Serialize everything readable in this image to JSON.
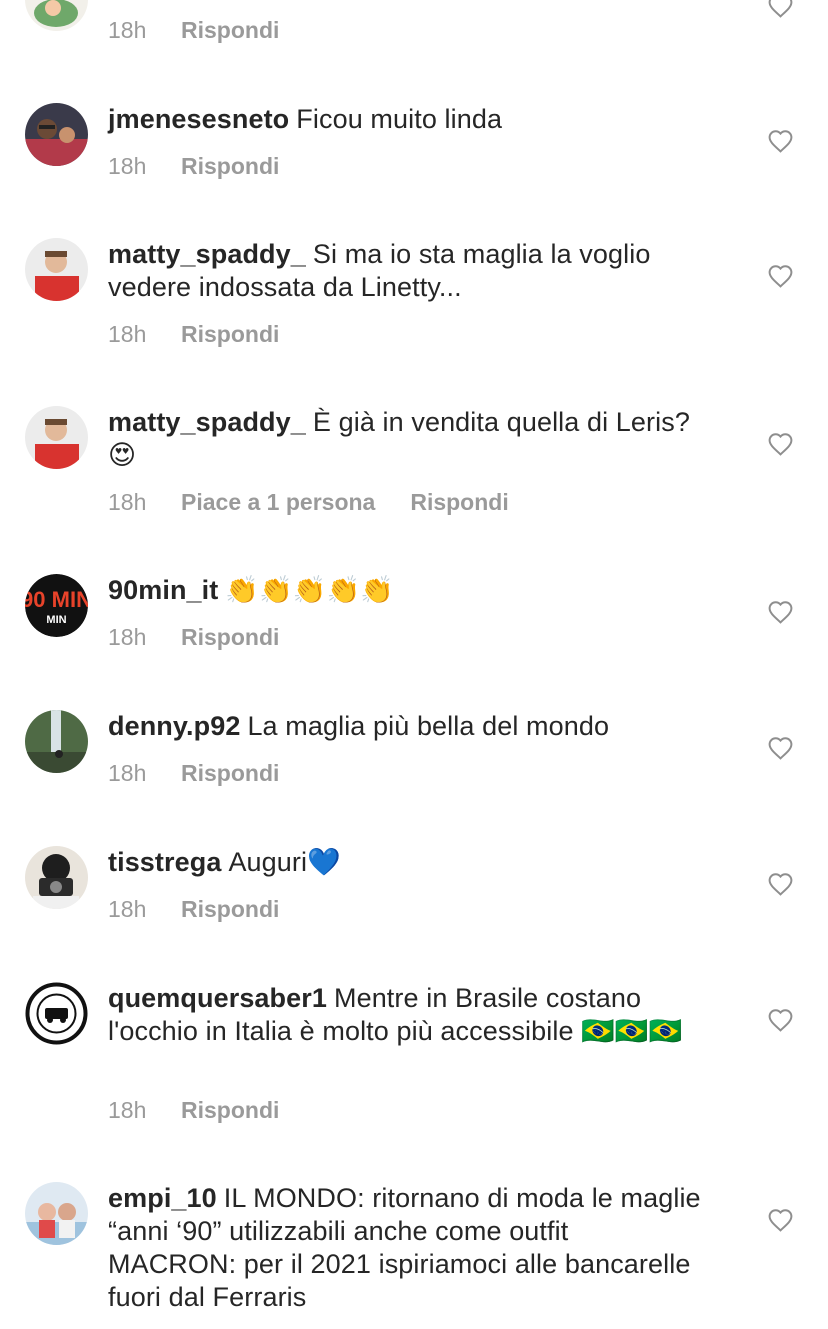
{
  "comments": [
    {
      "username": "",
      "text": "",
      "time": "18h",
      "reply": "Rispondi"
    },
    {
      "username": "jmenesesneto",
      "text": "Ficou muito linda",
      "time": "18h",
      "reply": "Rispondi"
    },
    {
      "username": "matty_spaddy_",
      "text": "Si ma io sta maglia la voglio vedere indossata da Linetty...",
      "time": "18h",
      "reply": "Rispondi"
    },
    {
      "username": "matty_spaddy_",
      "text": "È già in vendita quella di Leris?",
      "emoji": "😍",
      "time": "18h",
      "likes": "Piace a 1 persona",
      "reply": "Rispondi"
    },
    {
      "username": "90min_it",
      "text": "",
      "emoji": "👏👏👏👏👏",
      "time": "18h",
      "reply": "Rispondi",
      "avatar_text": "90 MIN"
    },
    {
      "username": "denny.p92",
      "text": "La maglia più bella del mondo",
      "time": "18h",
      "reply": "Rispondi"
    },
    {
      "username": "tisstrega",
      "text": "Auguri",
      "emoji": "💙",
      "time": "18h",
      "reply": "Rispondi"
    },
    {
      "username": "quemquersaber1",
      "text": "Mentre in Brasile costano l'occhio in Italia è molto più accessibile",
      "emoji": "🇧🇷🇧🇷🇧🇷",
      "time": "18h",
      "reply": "Rispondi"
    },
    {
      "username": "empi_10",
      "text": "IL MONDO: ritornano di moda le maglie “anni ‘90” utilizzabili anche come outfit",
      "text2": "MACRON: per il 2021 ispiriamoci alle bancarelle fuori dal Ferraris"
    }
  ],
  "icons": {
    "heart": "heart-outline-icon"
  },
  "colors": {
    "text": "#262626",
    "meta": "#9a9a9a",
    "heart": "#8e8e8e"
  }
}
